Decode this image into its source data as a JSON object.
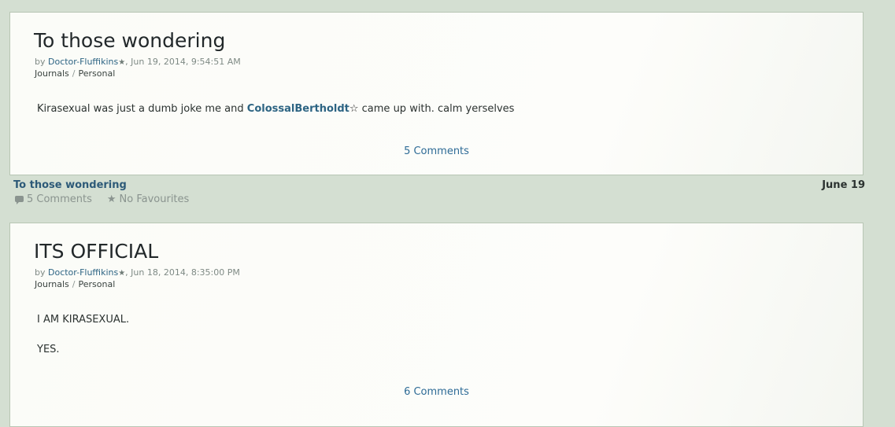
{
  "posts": [
    {
      "title": "To those wondering",
      "by_prefix": "by",
      "author": "Doctor-Fluffikins",
      "date_text": ", Jun 19, 2014, 9:54:51 AM",
      "category": "Journals",
      "subcategory": "Personal",
      "body_before": "Kirasexual was just a dumb joke me and",
      "mention": "ColossalBertholdt",
      "body_after": "came up with. calm yerselves",
      "comments_link": "5 Comments"
    },
    {
      "title": "ITS OFFICIAL",
      "by_prefix": "by",
      "author": "Doctor-Fluffikins",
      "date_text": ", Jun 18, 2014, 8:35:00 PM",
      "category": "Journals",
      "subcategory": "Personal",
      "body_line1": "I AM KIRASEXUAL.",
      "body_line2": "YES.",
      "comments_link": "6 Comments"
    }
  ],
  "strip": {
    "title": "To those wondering",
    "comments": "5 Comments",
    "favourites": "No Favourites",
    "date": "June 19"
  },
  "icons": {
    "author_star": "star-icon",
    "mention_star": "outline-star-icon",
    "comments": "speech-bubble-icon",
    "favourites": "star-icon"
  },
  "colors": {
    "background": "#d4dfd2",
    "link": "#2d6483",
    "card": "#fbfcf8"
  }
}
